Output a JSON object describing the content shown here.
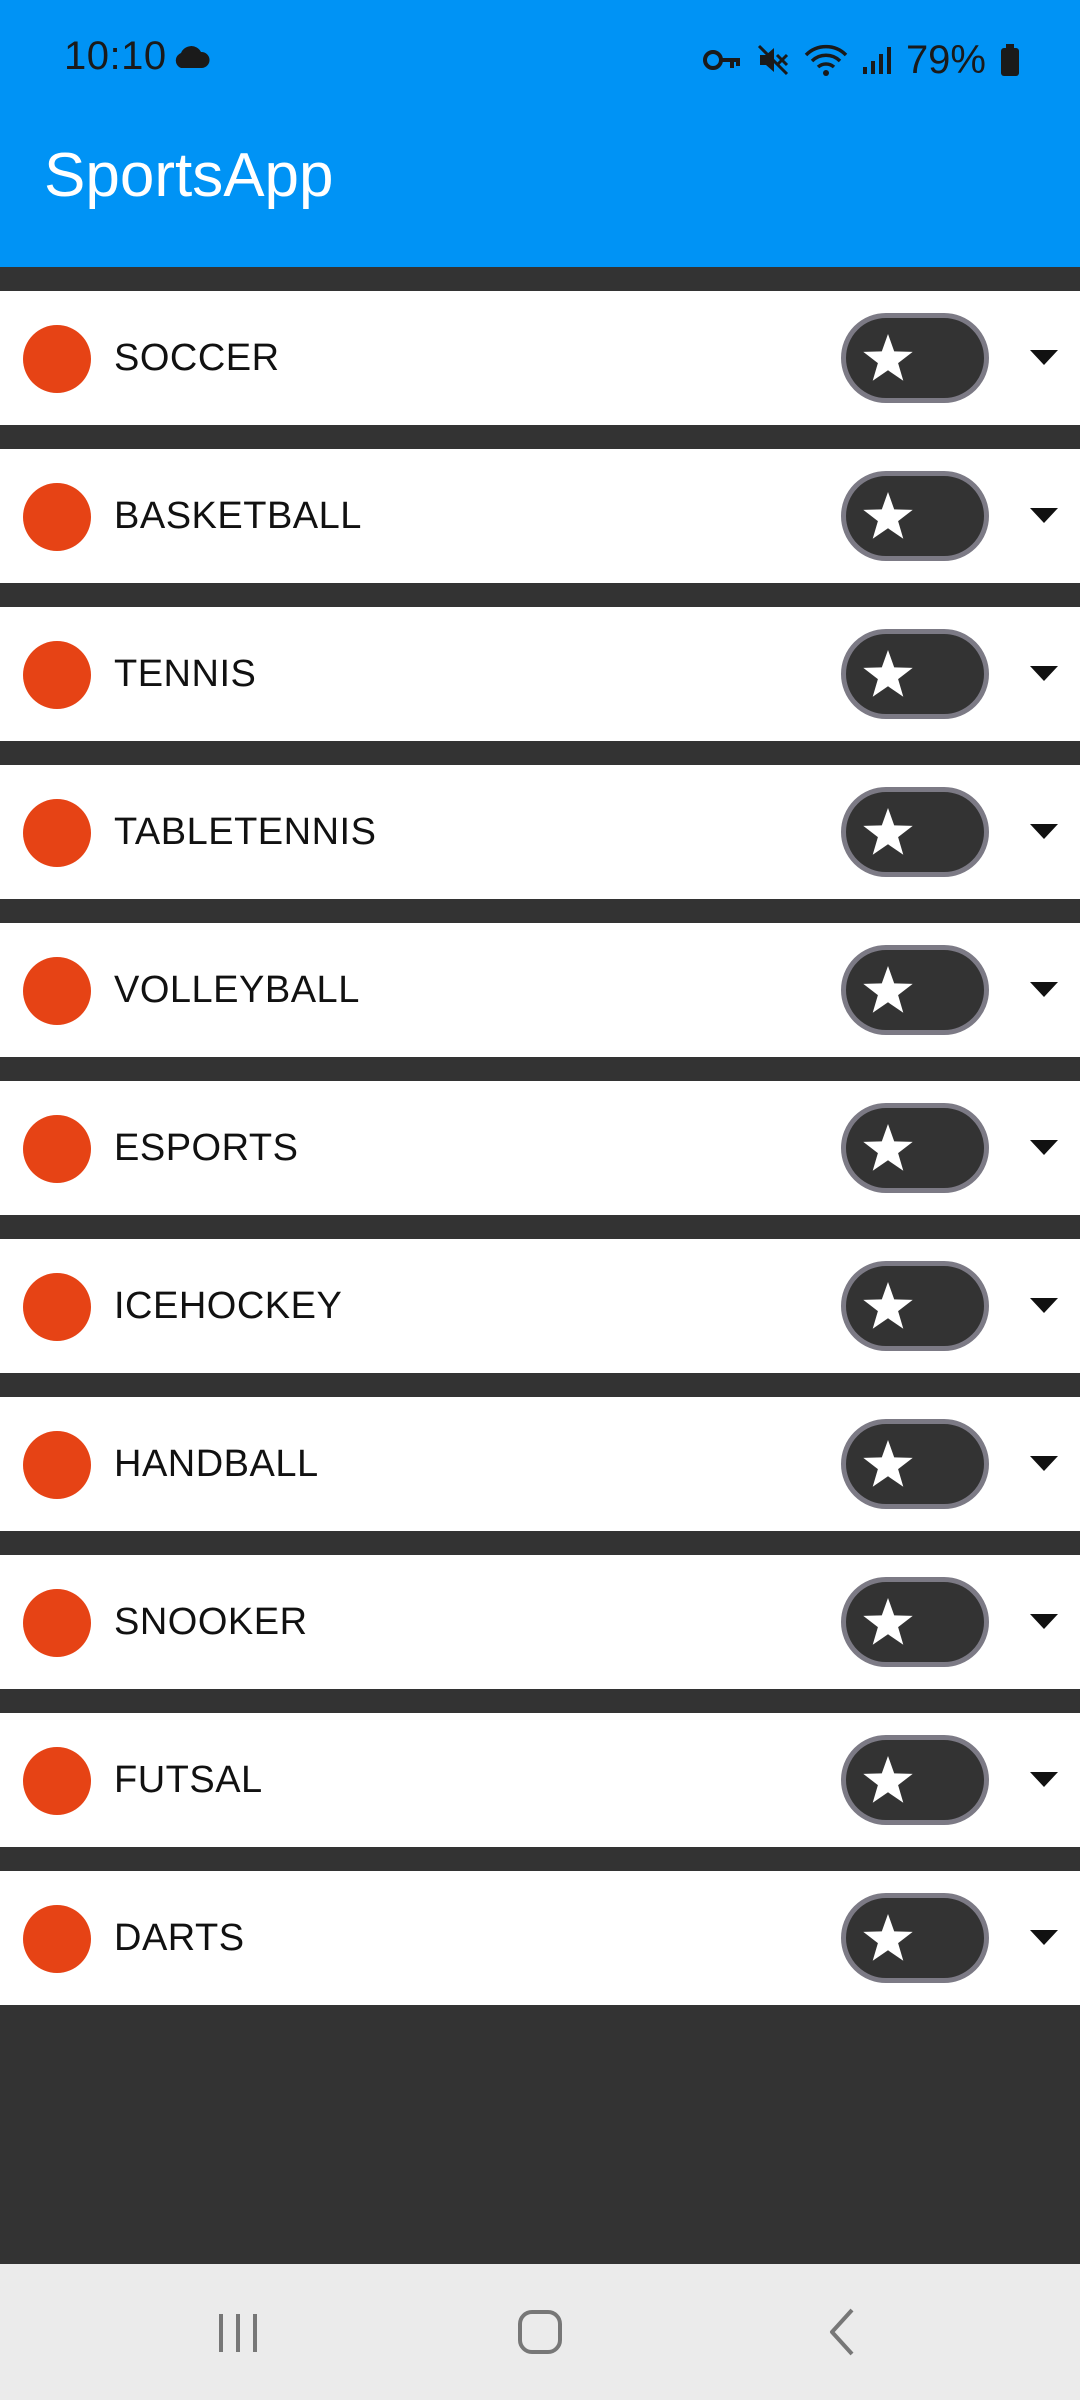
{
  "status_bar": {
    "time": "10:10",
    "battery": "79%",
    "icons": [
      "cloud-icon",
      "vpn-key-icon",
      "mute-icon",
      "wifi-icon",
      "signal-icon",
      "battery-icon"
    ]
  },
  "app_bar": {
    "title": "SportsApp",
    "color": "#0093f5"
  },
  "sports": [
    {
      "name": "SOCCER"
    },
    {
      "name": "BASKETBALL"
    },
    {
      "name": "TENNIS"
    },
    {
      "name": "TABLETENNIS"
    },
    {
      "name": "VOLLEYBALL"
    },
    {
      "name": "ESPORTS"
    },
    {
      "name": "ICEHOCKEY"
    },
    {
      "name": "HANDBALL"
    },
    {
      "name": "SNOOKER"
    },
    {
      "name": "FUTSAL"
    },
    {
      "name": "DARTS"
    }
  ],
  "row_icons": {
    "dot_color": "#e64315",
    "favorite": "star-icon",
    "expand": "chevron-down-icon"
  },
  "nav_bar": {
    "buttons": [
      "recents-icon",
      "home-icon",
      "back-icon"
    ]
  }
}
